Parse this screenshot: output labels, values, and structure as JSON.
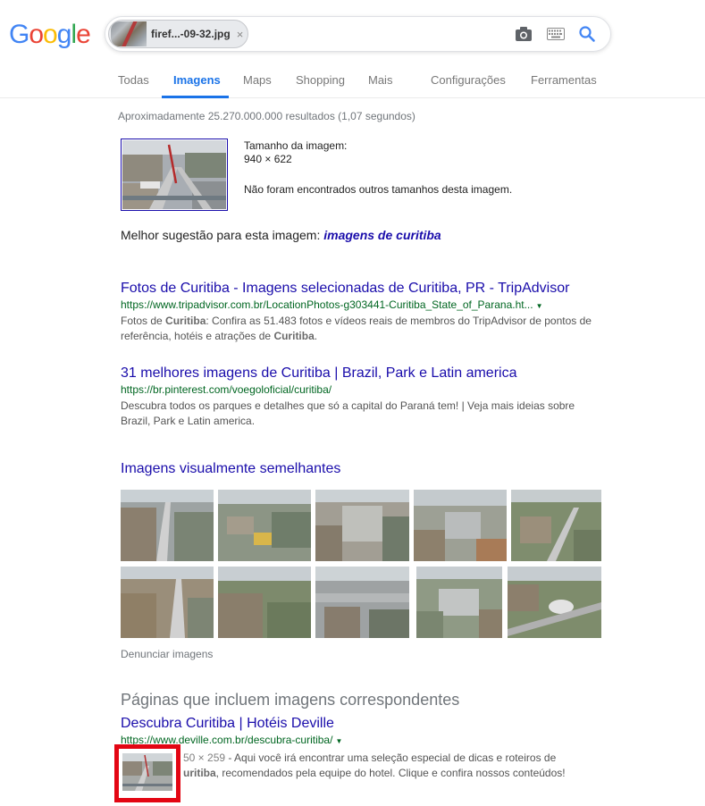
{
  "header": {
    "logo": [
      "G",
      "o",
      "o",
      "g",
      "l",
      "e"
    ],
    "logo_colors": [
      "#4285F4",
      "#EA4335",
      "#FBBC05",
      "#4285F4",
      "#34A853",
      "#EA4335"
    ],
    "chip_label": "firef...-09-32.jpg",
    "chip_close": "×"
  },
  "tabs": [
    {
      "label": "Todas"
    },
    {
      "label": "Imagens",
      "active": true
    },
    {
      "label": "Maps"
    },
    {
      "label": "Shopping"
    },
    {
      "label": "Mais"
    },
    {
      "label": "Configurações"
    },
    {
      "label": "Ferramentas"
    }
  ],
  "stats": "Aproximadamente 25.270.000.000 resultados (1,07 segundos)",
  "image_info": {
    "size_label": "Tamanho da imagem:",
    "size_value": "940 × 622",
    "no_other_sizes": "Não foram encontrados outros tamanhos desta imagem."
  },
  "best_guess": {
    "prefix": "Melhor sugestão para esta imagem: ",
    "query": "imagens de curitiba"
  },
  "results": [
    {
      "title": "Fotos de Curitiba - Imagens selecionadas de Curitiba, PR - TripAdvisor",
      "url": "https://www.tripadvisor.com.br/LocationPhotos-g303441-Curitiba_State_of_Parana.ht...",
      "snippet_parts": [
        "Fotos de ",
        "Curitiba",
        ": Confira as 51.483 fotos e vídeos reais de membros do TripAdvisor de pontos de referência, hotéis e atrações de ",
        "Curitiba",
        "."
      ]
    },
    {
      "title": "31 melhores imagens de Curitiba | Brazil, Park e Latin america",
      "url": "https://br.pinterest.com/voegoloficial/curitiba/",
      "snippet": "Descubra todos os parques e detalhes que só a capital do Paraná tem! | Veja mais ideias sobre Brazil, Park e Latin america."
    }
  ],
  "similar": {
    "title": "Imagens visualmente semelhantes",
    "report": "Denunciar imagens"
  },
  "pages": {
    "heading": "Páginas que incluem imagens correspondentes",
    "title": "Descubra Curitiba | Hotéis Deville",
    "url": "https://www.deville.com.br/descubra-curitiba/",
    "dims": "50 × 259",
    "snippet_parts": [
      " - Aqui você irá encontrar uma seleção especial de dicas e roteiros de ",
      "uritiba",
      ", recomendados pela equipe do hotel. Clique e confira nossos conteúdos!"
    ]
  }
}
